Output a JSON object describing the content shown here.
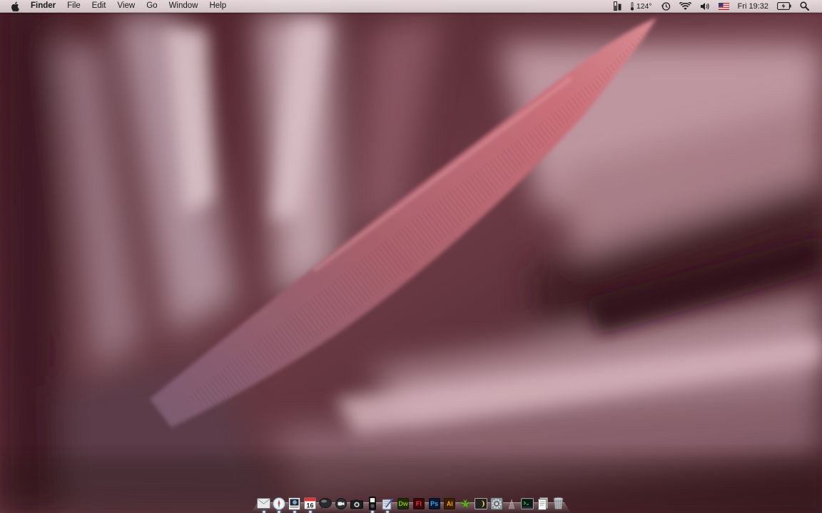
{
  "menubar": {
    "apple_icon": "apple-logo-icon",
    "app_name": "Finder",
    "menus": [
      "File",
      "Edit",
      "View",
      "Go",
      "Window",
      "Help"
    ],
    "status": {
      "temperature": "124°",
      "clock": "Fri 19:32",
      "icons": [
        "gpu-switch-icon",
        "temperature-sensor-icon",
        "time-machine-icon",
        "wifi-icon",
        "volume-icon",
        "us-flag-input-icon",
        "battery-icon",
        "spotlight-icon"
      ]
    }
  },
  "dock": {
    "items": [
      {
        "name": "dock-mail",
        "icon": "mail-icon",
        "running": true
      },
      {
        "name": "dock-safari",
        "icon": "safari-icon",
        "running": true
      },
      {
        "name": "dock-preview",
        "icon": "preview-icon",
        "running": true
      },
      {
        "name": "dock-ical",
        "icon": "calendar-icon",
        "day": "16",
        "running": true
      },
      {
        "name": "dock-messages",
        "icon": "chat-bubble-icon",
        "running": false
      },
      {
        "name": "dock-facetime",
        "icon": "video-camera-icon",
        "running": false
      },
      {
        "name": "dock-photo-booth",
        "icon": "camera-icon",
        "running": false
      },
      {
        "name": "dock-ipod",
        "icon": "music-player-icon",
        "running": true
      },
      {
        "name": "dock-script-editor",
        "icon": "pen-paper-icon",
        "running": true
      },
      {
        "name": "dock-dreamweaver",
        "icon": "dreamweaver-icon",
        "label": "Dw",
        "color": "#8fb81a",
        "running": false
      },
      {
        "name": "dock-flash",
        "icon": "flash-icon",
        "label": "Fl",
        "color": "#c4262e",
        "running": false
      },
      {
        "name": "dock-photoshop",
        "icon": "photoshop-icon",
        "label": "Ps",
        "color": "#1f6ab2",
        "running": false
      },
      {
        "name": "dock-illustrator",
        "icon": "illustrator-icon",
        "label": "Ai",
        "color": "#e08a14",
        "running": false
      },
      {
        "name": "dock-cyberduck",
        "icon": "frog-icon",
        "running": false
      },
      {
        "name": "dock-utility",
        "icon": "half-moon-window-icon",
        "running": false
      },
      {
        "name": "dock-system-preferences",
        "icon": "gear-icon",
        "running": false
      },
      {
        "name": "dock-downloads",
        "icon": "downloads-stack-icon",
        "running": false
      },
      {
        "name": "dock-terminal",
        "icon": "terminal-icon",
        "running": false
      },
      {
        "name": "dock-documents",
        "icon": "document-stack-icon",
        "running": false
      },
      {
        "name": "dock-trash",
        "icon": "trash-icon",
        "running": false
      }
    ]
  },
  "colors": {
    "wallpaper_base": "#5a2f38",
    "wallpaper_highlight": "#c98a96"
  }
}
